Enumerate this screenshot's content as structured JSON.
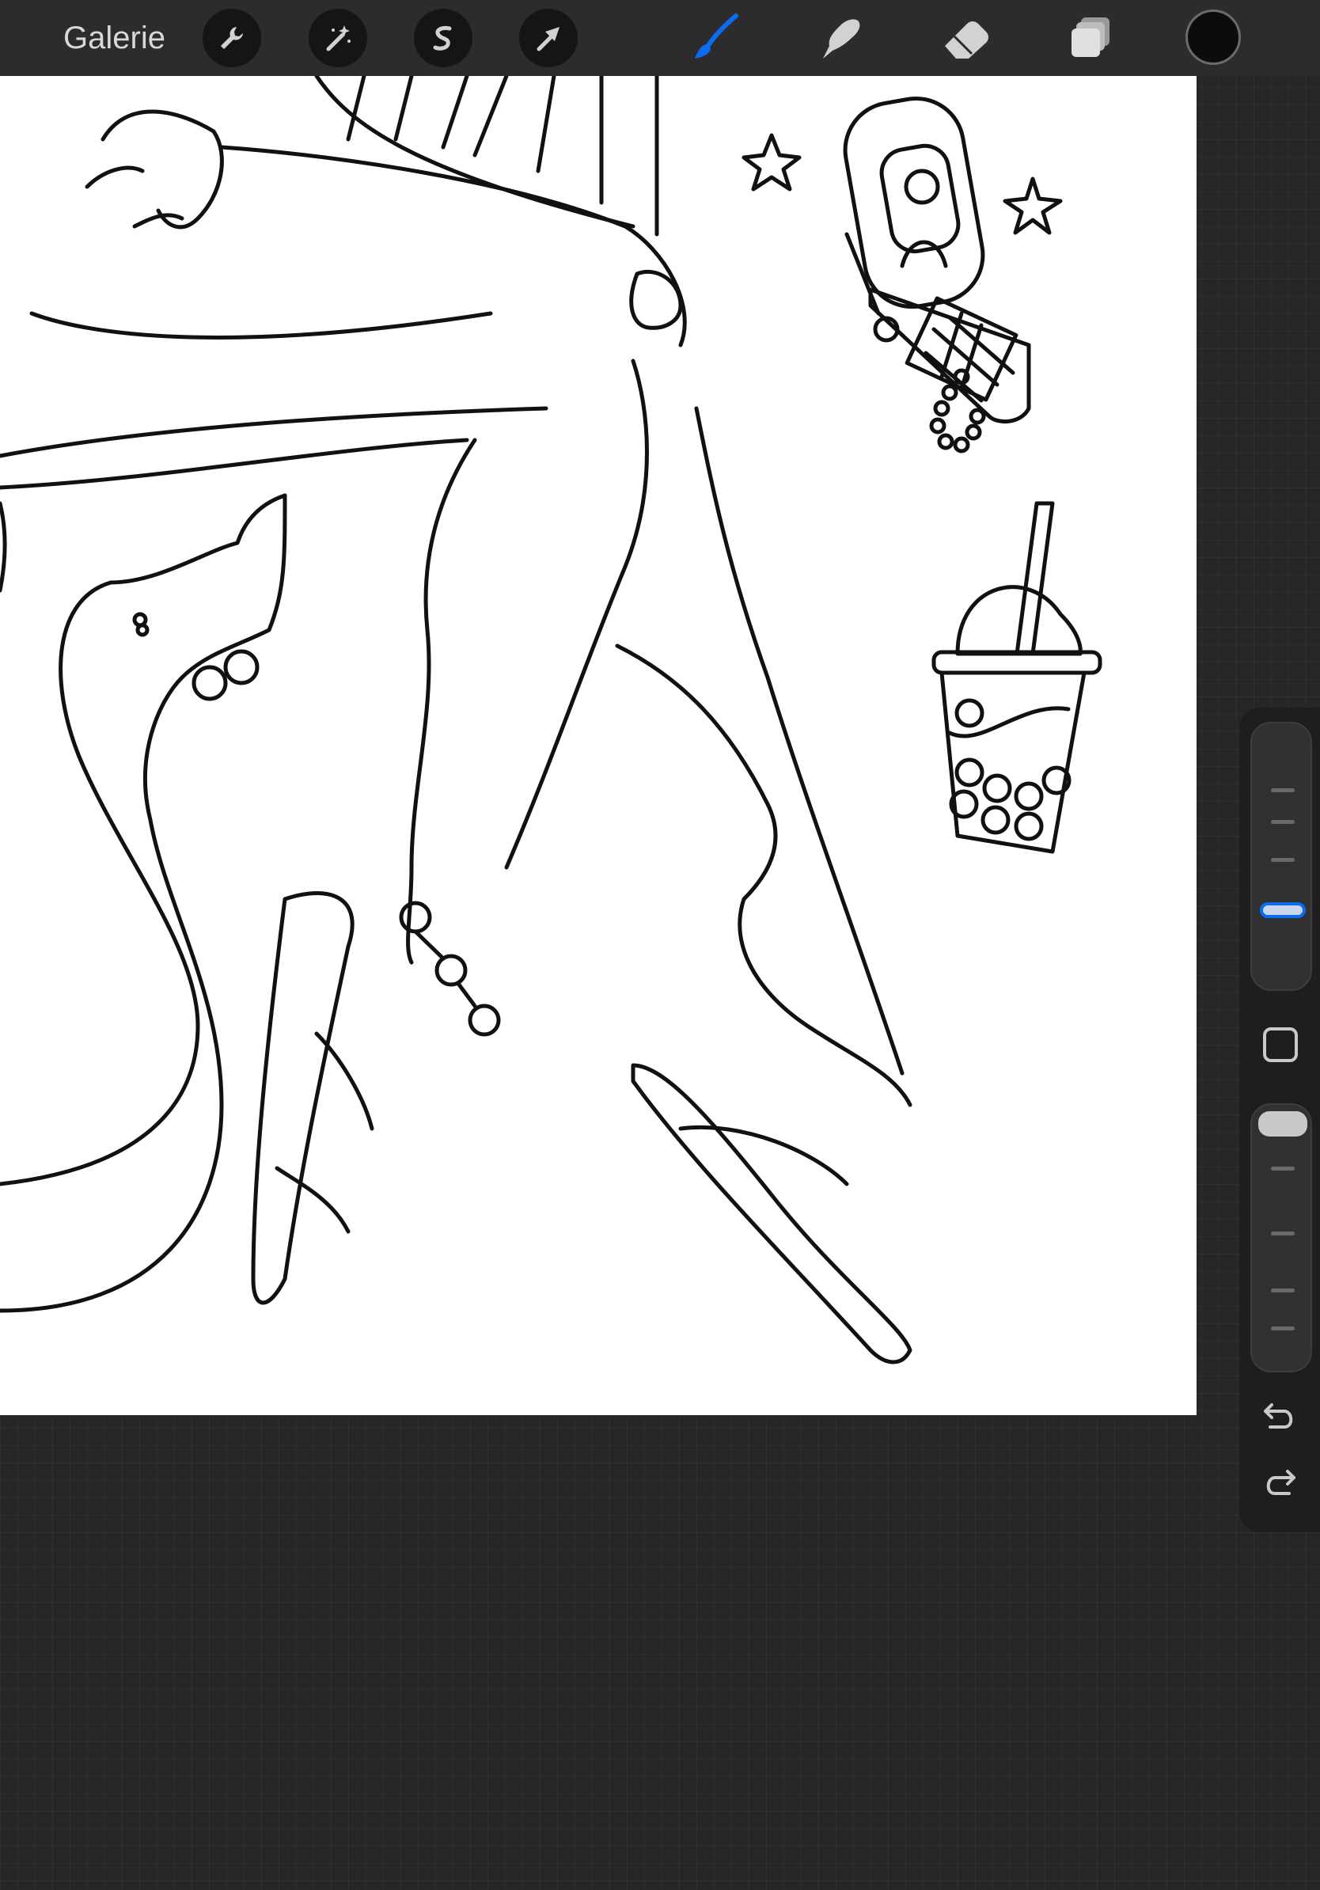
{
  "topbar": {
    "gallery_label": "Galerie",
    "actions": [
      {
        "name": "actions-wrench",
        "icon": "wrench-icon"
      },
      {
        "name": "adjustments-wand",
        "icon": "magic-wand-icon"
      },
      {
        "name": "selection-tool",
        "icon": "selection-s-icon"
      },
      {
        "name": "transform-tool",
        "icon": "arrow-cursor-icon"
      }
    ],
    "tools": [
      {
        "name": "brush-tool",
        "icon": "brush-icon",
        "active": true,
        "color": "#0a6cf0"
      },
      {
        "name": "smudge-tool",
        "icon": "smudge-finger-icon",
        "active": false
      },
      {
        "name": "eraser-tool",
        "icon": "eraser-icon",
        "active": false
      },
      {
        "name": "layers-button",
        "icon": "layers-icon",
        "active": false
      }
    ],
    "current_color": "#0c0c0c"
  },
  "sidebar": {
    "brush_size": {
      "icon": "brush-size-slider",
      "level": 0.33,
      "accent": "#0a6cf0"
    },
    "modify_button": {
      "icon": "square-modify-icon"
    },
    "opacity": {
      "icon": "opacity-slider",
      "level": 1.0
    },
    "undo": {
      "icon": "undo-arrow-icon"
    },
    "redo": {
      "icon": "redo-arrow-icon"
    }
  },
  "canvas": {
    "background": "#ffffff",
    "artwork": "line-art-drawing"
  },
  "colors": {
    "app_background": "#262628",
    "toolbar": "#2c2c2e",
    "sidebar": "#1e1e20",
    "accent": "#0a6cf0"
  }
}
